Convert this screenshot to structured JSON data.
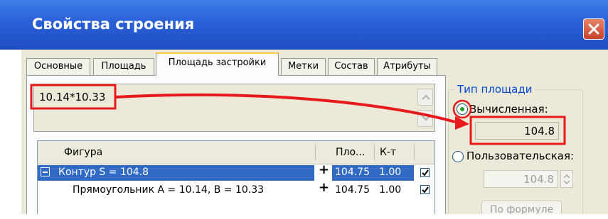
{
  "window": {
    "title": "Свойства строения"
  },
  "tabs": [
    {
      "label": "Основные"
    },
    {
      "label": "Площадь"
    },
    {
      "label": "Площадь застройки",
      "active": true
    },
    {
      "label": "Метки"
    },
    {
      "label": "Состав"
    },
    {
      "label": "Атрибуты"
    }
  ],
  "formula": {
    "value": "10.14*10.33"
  },
  "table": {
    "columns": [
      "Фигура",
      "Пло...",
      "К-т"
    ],
    "rows": [
      {
        "figure": "Контур S = 104.8",
        "plus": "+",
        "area": "104.75",
        "coef": "1.00",
        "checked": true,
        "selected": true,
        "expanded": true
      },
      {
        "figure": "Прямоугольник A = 10.14, B = 10.33",
        "plus": "+",
        "area": "104.75",
        "coef": "1.00",
        "checked": true,
        "selected": false
      }
    ]
  },
  "area_type": {
    "group_title": "Тип площади",
    "calculated_label": "Вычисленная:",
    "calculated_value": "104.8",
    "user_label": "Пользовательская:",
    "user_value": "104.8",
    "formula_button": "По формуле",
    "selected": "calculated"
  },
  "colors": {
    "titlebar": "#2a5fd6",
    "dialog_bg": "#ece9d8",
    "selection": "#316ac5",
    "annotation": "#e8191b",
    "group_title": "#0046d5"
  },
  "icons": {
    "close": "close-icon",
    "scroll_up": "chevron-up-icon",
    "scroll_down": "chevron-down-icon",
    "collapse": "minus-box-icon",
    "check": "check-icon"
  }
}
